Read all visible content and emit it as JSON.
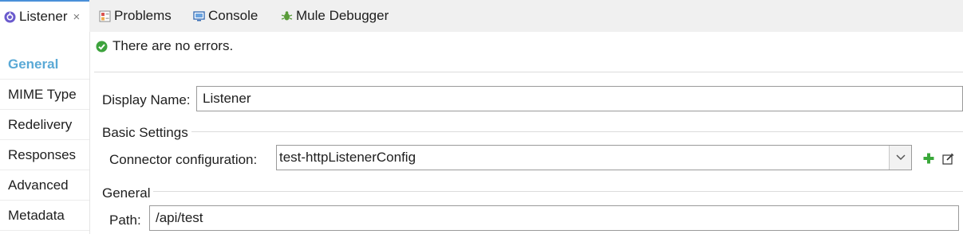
{
  "tabs": [
    {
      "label": "Listener",
      "icon": "listener-icon",
      "close": "×"
    },
    {
      "label": "Problems",
      "icon": "problems-icon"
    },
    {
      "label": "Console",
      "icon": "console-icon"
    },
    {
      "label": "Mule Debugger",
      "icon": "debugger-icon"
    }
  ],
  "sidebar": {
    "items": [
      {
        "label": "General",
        "selected": true
      },
      {
        "label": "MIME Type"
      },
      {
        "label": "Redelivery"
      },
      {
        "label": "Responses"
      },
      {
        "label": "Advanced"
      },
      {
        "label": "Metadata"
      }
    ]
  },
  "status": {
    "text": "There are no errors.",
    "icon": "check-icon",
    "color": "#3da33d"
  },
  "form": {
    "display_name_label": "Display Name:",
    "display_name_value": "Listener",
    "basic_settings_title": "Basic Settings",
    "connector_label": "Connector configuration:",
    "connector_value": "test-httpListenerConfig",
    "general_title": "General",
    "path_label": "Path:",
    "path_value": "/api/test"
  },
  "colors": {
    "accent": "#5aa9d6",
    "tab_active_border": "#4a90d9",
    "add_icon": "#3aa83a"
  }
}
